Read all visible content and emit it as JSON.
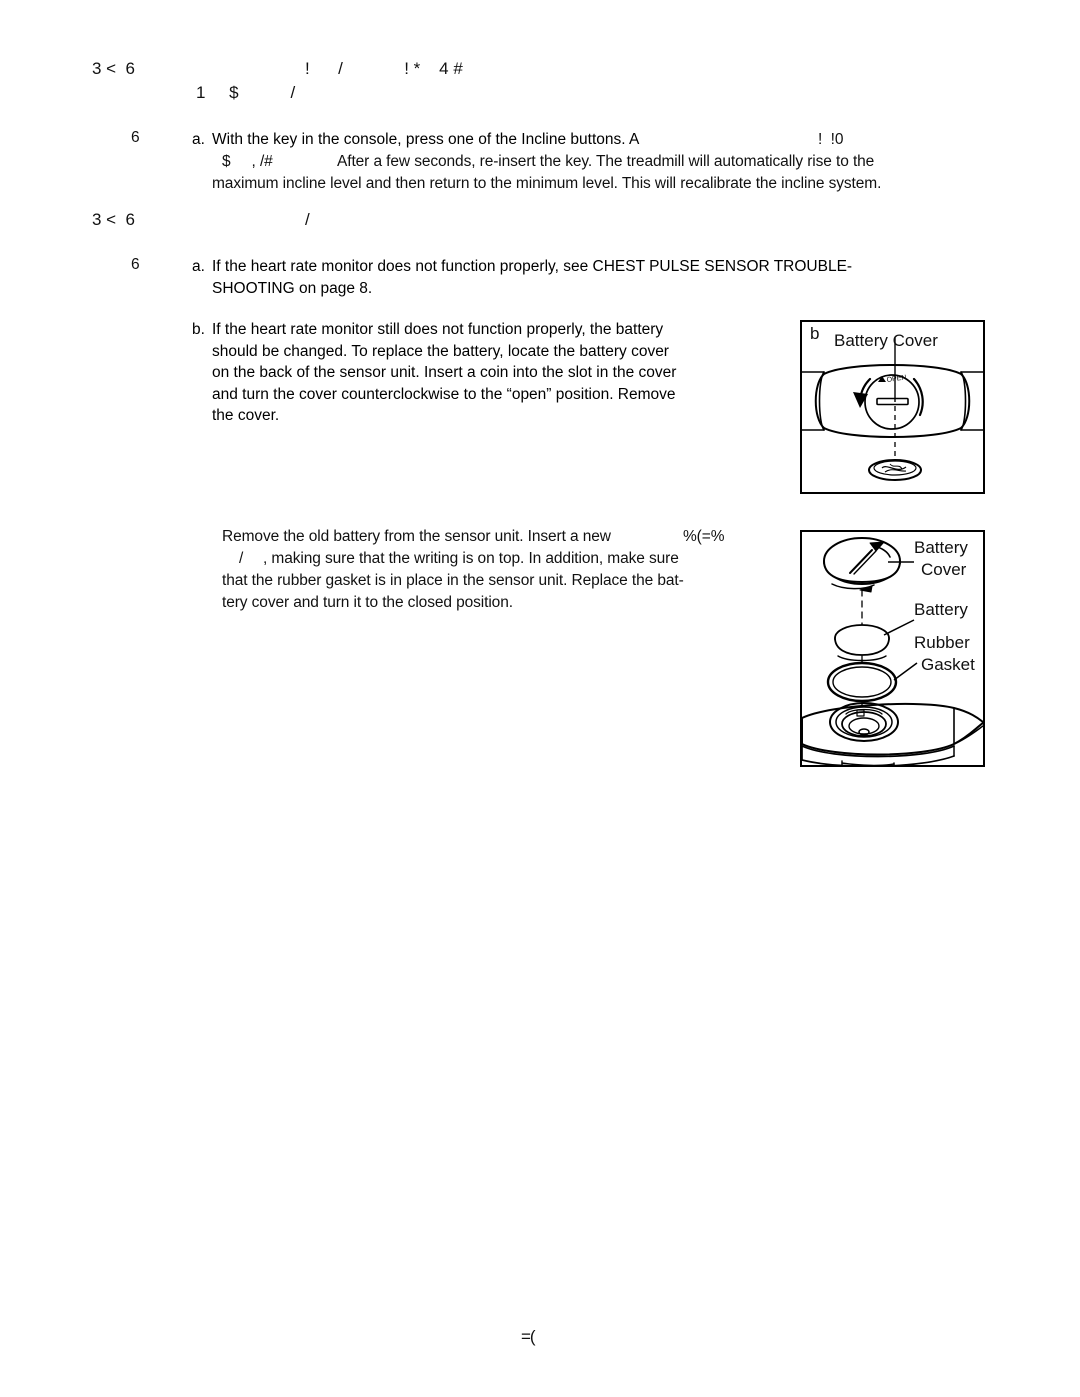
{
  "document": {
    "kind": "scanned-manual-page",
    "footer_glyph": "=("
  },
  "sections": [
    {
      "id": "incline-calibration",
      "heading_glyph_line1": "3 <  6                                    !      /             ! *    4 #",
      "heading_glyph_line2": "1     $           /",
      "marker_glyph": "6",
      "steps": [
        {
          "label": "a.",
          "line1": "With the key in the console, press one of the Incline buttons. A",
          "line1_glyph_tail": "!  !0",
          "line2_glyph_lead": "$     , /#",
          "line2": "After a few seconds, re-insert the key. The treadmill will automatically rise to the",
          "line3": "maximum incline level and then return to the minimum level. This will recalibrate the incline system."
        }
      ]
    },
    {
      "id": "heart-rate-monitor",
      "heading_glyph_line1": "3 <  6                                    /",
      "marker_glyph": "6",
      "steps": [
        {
          "label": "a.",
          "text": "If the heart rate monitor does not function properly, see CHEST PULSE SENSOR TROUBLE-\nSHOOTING on page 8."
        },
        {
          "label": "b.",
          "text": "If the heart rate monitor still does not function properly, the battery\nshould be changed. To replace the battery, locate the battery cover\non the back of the sensor unit. Insert a coin into the slot in the cover\nand turn the cover counterclockwise to the “open” position. Remove\nthe cover."
        }
      ],
      "continuation": {
        "line1": "Remove the old battery from the sensor unit. Insert a new",
        "line1_glyph_tail": "%(=%",
        "line2_glyph_lead": "/",
        "line2": ", making sure that the writing is on top. In addition, make sure",
        "line3": "that the rubber gasket is in place in the sensor unit. Replace the bat-",
        "line4": "tery cover and turn it to the closed position."
      }
    }
  ],
  "figures": [
    {
      "id": "battery-cover-figure",
      "step_letter": "b",
      "title": "Battery Cover",
      "open_marking": "OPEN",
      "description": "Back of chest sensor unit showing circular battery cover with coin slot, counterclockwise rotation arrow, and a coin below."
    },
    {
      "id": "exploded-battery-figure",
      "labels": [
        {
          "id": "battery-cover",
          "line1": "Battery",
          "line2": "Cover"
        },
        {
          "id": "battery",
          "line1": "Battery"
        },
        {
          "id": "rubber-gasket",
          "line1": "Rubber",
          "line2": "Gasket"
        }
      ],
      "description": "Exploded view of sensor unit with battery cover, battery, and rubber gasket stacked above the sensor housing."
    }
  ],
  "colors": {
    "ink": "#111111",
    "page": "#ffffff",
    "line": "#000000"
  }
}
